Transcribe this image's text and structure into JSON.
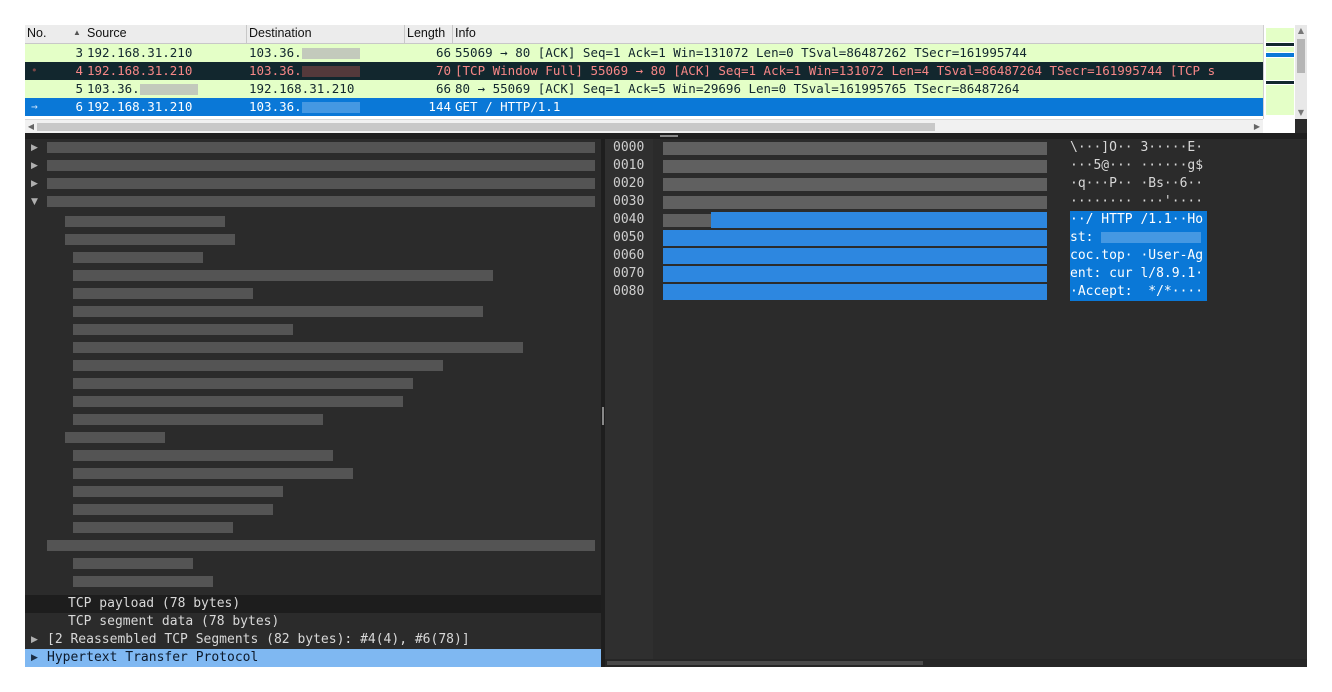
{
  "packet_list": {
    "columns": [
      "No.",
      "Source",
      "Destination",
      "Length",
      "Info"
    ],
    "sort_indicator": "sort-ascending-icon",
    "rows": [
      {
        "no": "3",
        "src": "192.168.31.210",
        "dst": "103.36.",
        "len": "66",
        "info": "55069 → 80 [ACK] Seq=1 Ack=1 Win=131072 Len=0 TSval=86487262 TSecr=161995744",
        "style": "green"
      },
      {
        "no": "4",
        "src": "192.168.31.210",
        "dst": "103.36.",
        "len": "70",
        "info": "[TCP Window Full] 55069 → 80 [ACK] Seq=1 Ack=1 Win=131072 Len=4 TSval=86487264 TSecr=161995744 [TCP s",
        "style": "dark"
      },
      {
        "no": "5",
        "src": "103.36.",
        "dst": "192.168.31.210",
        "len": "66",
        "info": "80 → 55069 [ACK] Seq=1 Ack=5 Win=29696 Len=0 TSval=161995765 TSecr=86487264",
        "style": "green"
      },
      {
        "no": "6",
        "src": "192.168.31.210",
        "dst": "103.36.",
        "len": "144",
        "info": "GET / HTTP/1.1",
        "style": "selected"
      }
    ],
    "row_colors": {
      "green": "#e4ffc7",
      "dark": "#12272e",
      "selected": "#0a78d7"
    }
  },
  "details": {
    "lines": {
      "payload": "TCP payload (78 bytes)",
      "segment": "TCP segment data (78 bytes)",
      "reassembled": "[2 Reassembled TCP Segments (82 bytes): #4(4), #6(78)]",
      "http": "Hypertext Transfer Protocol"
    },
    "highlight_color": "#7fb8f2"
  },
  "bytes": {
    "offsets": [
      "0000",
      "0010",
      "0020",
      "0030",
      "0040",
      "0050",
      "0060",
      "0070",
      "0080"
    ],
    "ascii": [
      "\\···]O·· 3·····E·",
      "···5@··· ······g$",
      "·q···P·· ·Bs··6··",
      "········ ···'····",
      "··/ HTTP /1.1··Ho",
      "st: ",
      "coc.top· ·User-Ag",
      "ent: cur l/8.9.1·",
      "·Accept:  */*····"
    ],
    "selection_color": "#0a78d7"
  }
}
